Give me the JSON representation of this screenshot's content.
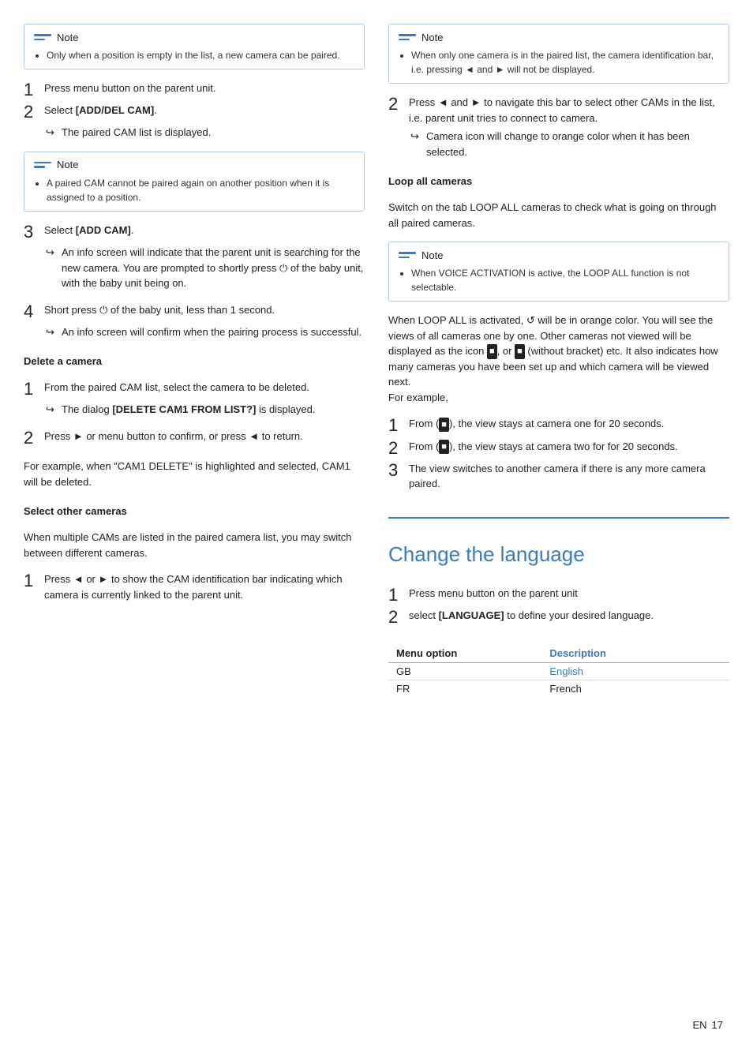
{
  "left": {
    "note1": {
      "title": "Note",
      "body": "Only when a position is empty in the list, a new camera can be paired."
    },
    "steps_add": [
      {
        "num": "1",
        "text": "Press menu button on the parent unit."
      },
      {
        "num": "2",
        "text": "Select [ADD/DEL CAM].",
        "arrow": "The paired CAM list is displayed."
      }
    ],
    "note2": {
      "title": "Note",
      "body": "A paired CAM cannot be paired again on another position when it is assigned to a position."
    },
    "step3": {
      "num": "3",
      "text": "Select [ADD CAM].",
      "arrow": "An info screen will indicate that the parent unit is searching for the new camera. You are prompted to shortly press ⏻ of the baby unit, with the baby unit being on."
    },
    "step4": {
      "num": "4",
      "text": "Short press ⏻ of the baby unit, less than 1 second.",
      "arrow": "An info screen will confirm when the pairing process is successful."
    },
    "delete_heading": "Delete a camera",
    "delete_steps": [
      {
        "num": "1",
        "text": "From the paired CAM list, select the camera to be deleted.",
        "arrow": "The dialog [DELETE CAM1 FROM LIST?] is displayed."
      },
      {
        "num": "2",
        "text": "Press ► or menu button to confirm, or press ◄ to return."
      }
    ],
    "delete_body": "For example, when \"CAM1 DELETE\" is highlighted and selected, CAM1 will be deleted.",
    "select_heading": "Select other cameras",
    "select_body": "When multiple CAMs are listed in the paired camera list, you may switch between different cameras.",
    "select_step1": {
      "num": "1",
      "text": "Press ◄ or ► to show the CAM identification bar indicating which camera is currently linked to the parent unit."
    }
  },
  "right": {
    "note1": {
      "title": "Note",
      "body": "When only one camera is in the paired list, the camera identification bar, i.e. pressing ◄ and ► will not be displayed."
    },
    "step2": {
      "num": "2",
      "text": "Press ◄ and ► to navigate this bar to select other CAMs in the list, i.e. parent unit tries to connect to camera.",
      "arrow1": "Camera icon will change to orange color when it has been selected."
    },
    "loop_heading": "Loop all cameras",
    "loop_body": "Switch on the tab LOOP ALL cameras to check what is going on through all paired cameras.",
    "note2": {
      "title": "Note",
      "body": "When VOICE ACTIVATION is active, the LOOP ALL function is not selectable."
    },
    "loop_text": "When LOOP ALL is activated, ↺ will be in orange color. You will see the views of all cameras one by one. Other cameras not viewed will be displayed as the icon ■◄1, or ■◄2 (without bracket) etc. It also indicates how many cameras you have been set up and which camera will be viewed next.\nFor example,",
    "for_example_steps": [
      {
        "num": "1",
        "text": "From (■◄1), the view stays at camera one for 20 seconds."
      },
      {
        "num": "2",
        "text": "From (■◄2), the view stays at camera two for for 20 seconds."
      },
      {
        "num": "3",
        "text": "The view switches to another camera if there is any more camera paired."
      }
    ],
    "section_title": "Change the language",
    "change_steps": [
      {
        "num": "1",
        "text": "Press menu button on the parent unit"
      },
      {
        "num": "2",
        "text": "select [LANGUAGE] to define your desired language."
      }
    ],
    "table": {
      "col1": "Menu option",
      "col2": "Description",
      "rows": [
        {
          "option": "GB",
          "desc": "English"
        },
        {
          "option": "FR",
          "desc": "French"
        }
      ]
    }
  },
  "page_label": "EN",
  "page_num": "17"
}
